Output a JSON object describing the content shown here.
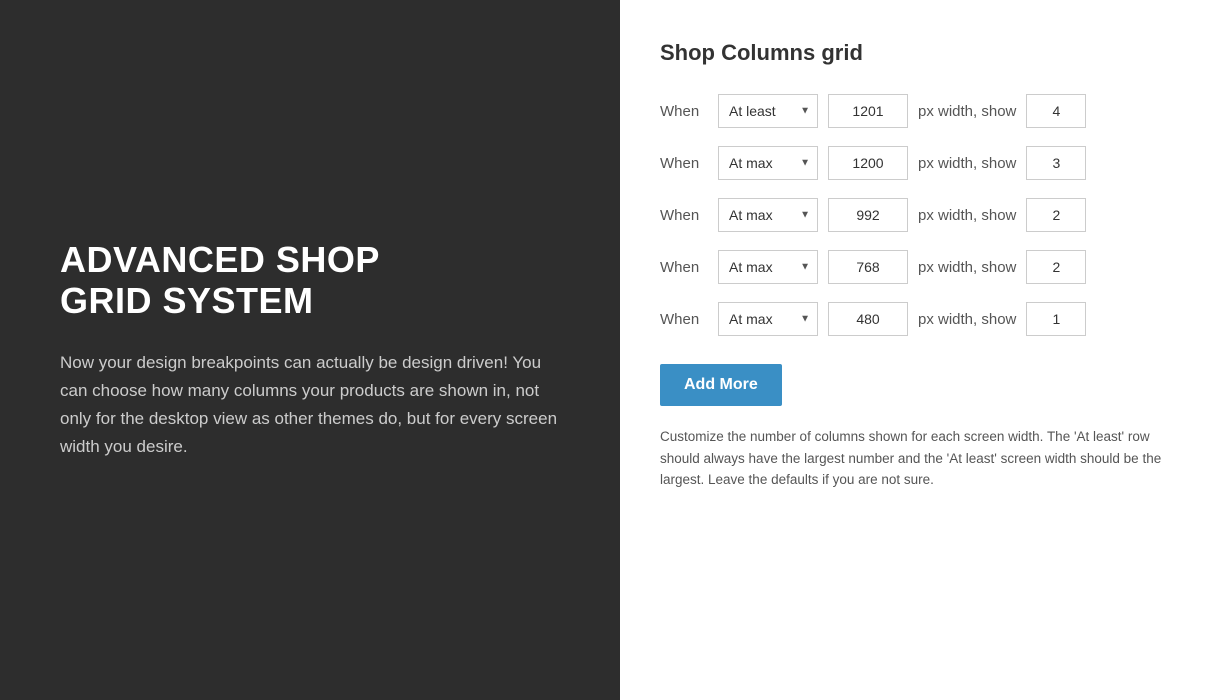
{
  "left": {
    "title_line1": "ADVANCED SHOP",
    "title_line2": "GRID SYSTEM",
    "description": "Now your design breakpoints can actually be design driven! You can choose how many columns your products are shown in, not only for the desktop view as other themes do, but for every screen width you desire."
  },
  "right": {
    "section_title": "Shop Columns grid",
    "rows": [
      {
        "when": "When",
        "condition": "At least",
        "px_value": "1201",
        "px_label": "px width, show",
        "columns": "4"
      },
      {
        "when": "When",
        "condition": "At max",
        "px_value": "1200",
        "px_label": "px width, show",
        "columns": "3"
      },
      {
        "when": "When",
        "condition": "At max",
        "px_value": "992",
        "px_label": "px width, show",
        "columns": "2"
      },
      {
        "when": "When",
        "condition": "At max",
        "px_value": "768",
        "px_label": "px width, show",
        "columns": "2"
      },
      {
        "when": "When",
        "condition": "At max",
        "px_value": "480",
        "px_label": "px width, show",
        "columns": "1"
      }
    ],
    "add_more_label": "Add More",
    "help_text": "Customize the number of columns shown for each screen width. The 'At least' row should always have the largest number and the 'At least' screen width should be the largest. Leave the defaults if you are not sure."
  }
}
